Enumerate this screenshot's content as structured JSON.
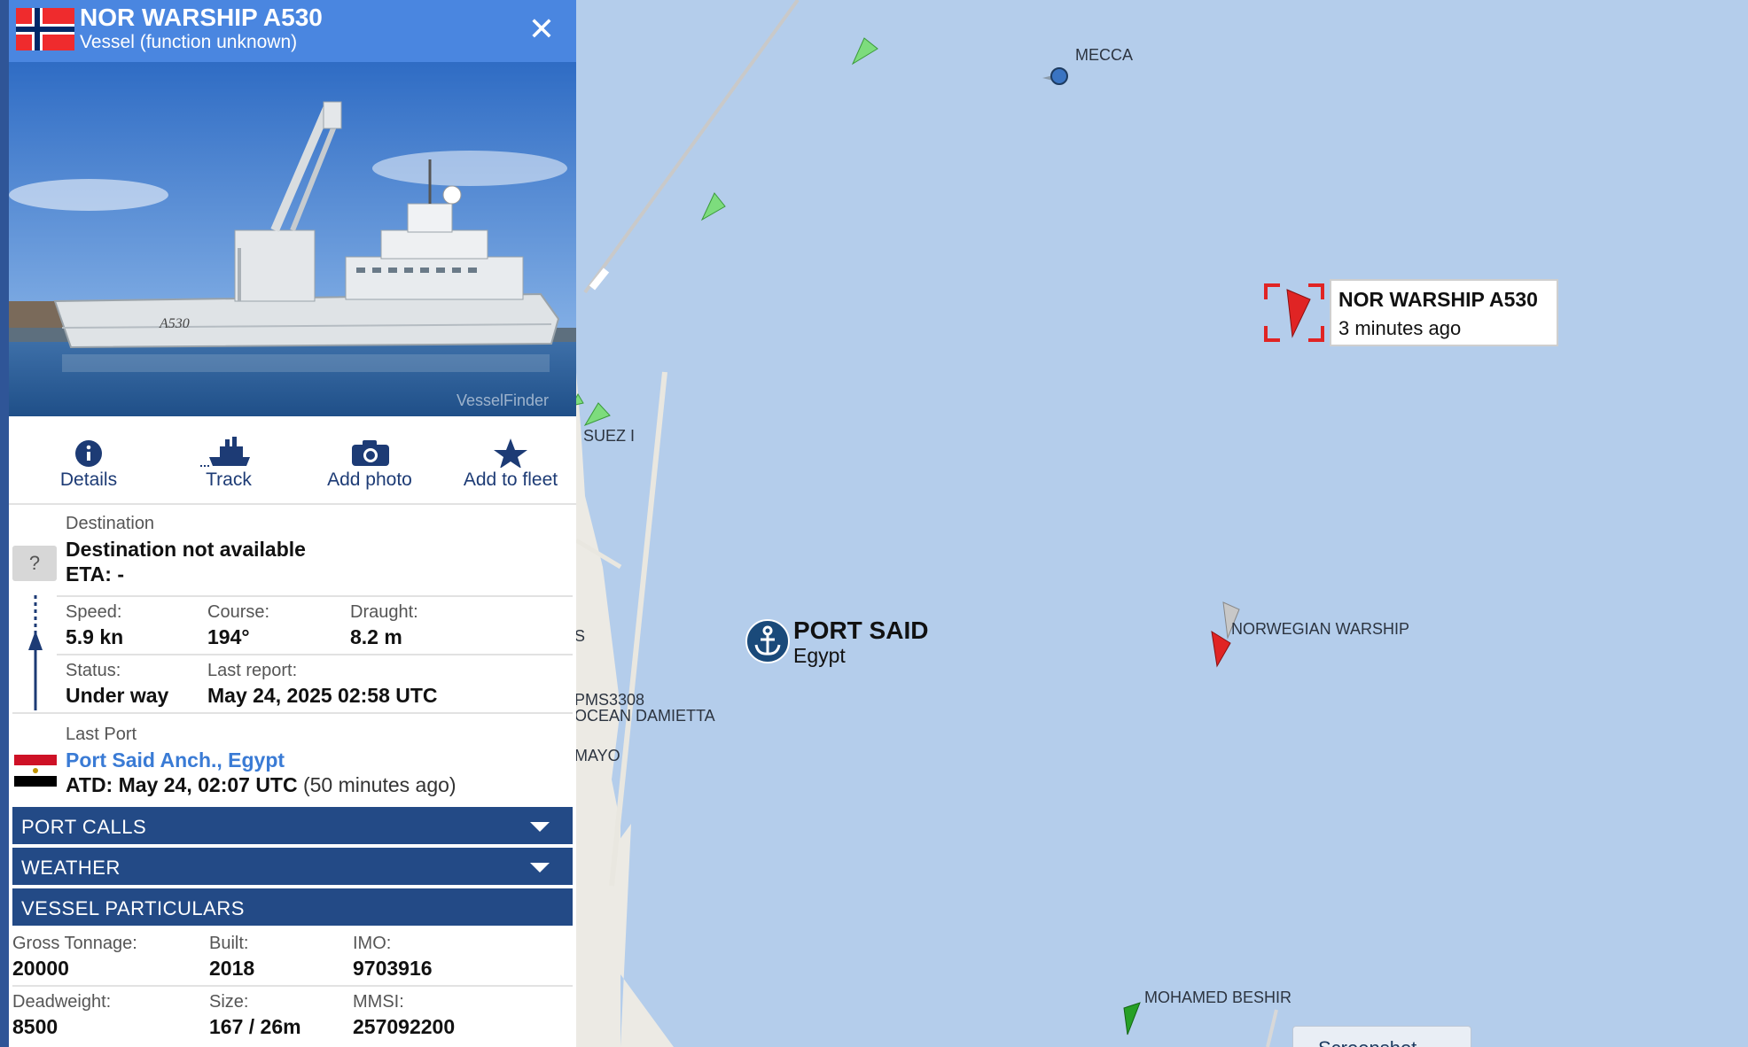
{
  "panel": {
    "title": "NOR WARSHIP A530",
    "subtitle": "Vessel (function unknown)",
    "close_symbol": "✕",
    "photo_watermark": "VesselFinder",
    "photo_hull_text": "A530",
    "actions": [
      {
        "label": "Details",
        "icon": "info-icon"
      },
      {
        "label": "Track",
        "icon": "ship-track-icon"
      },
      {
        "label": "Add photo",
        "icon": "camera-icon"
      },
      {
        "label": "Add to fleet",
        "icon": "star-icon"
      }
    ],
    "destination": {
      "label": "Destination",
      "value": "Destination not available",
      "eta": "ETA: -",
      "unknown_icon": "?"
    },
    "speed": {
      "label": "Speed:",
      "value": "5.9 kn"
    },
    "course": {
      "label": "Course:",
      "value": "194°"
    },
    "draught": {
      "label": "Draught:",
      "value": "8.2 m"
    },
    "status": {
      "label": "Status:",
      "value": "Under way"
    },
    "last_report": {
      "label": "Last report:",
      "value": "May 24, 2025 02:58 UTC"
    },
    "last_port": {
      "label": "Last Port",
      "name": "Port Said Anch., Egypt",
      "atd": "ATD: May 24, 02:07 UTC",
      "ago": "(50 minutes ago)"
    },
    "sections": [
      {
        "label": "PORT CALLS",
        "expandable": true
      },
      {
        "label": "WEATHER",
        "expandable": true
      },
      {
        "label": "VESSEL PARTICULARS",
        "expandable": false
      }
    ],
    "particulars": {
      "gross_tonnage": {
        "label": "Gross Tonnage:",
        "value": "20000"
      },
      "built": {
        "label": "Built:",
        "value": "2018"
      },
      "imo": {
        "label": "IMO:",
        "value": "9703916"
      },
      "deadweight": {
        "label": "Deadweight:",
        "value": "8500"
      },
      "size": {
        "label": "Size:",
        "value": "167 / 26m"
      },
      "mmsi": {
        "label": "MMSI:",
        "value": "257092200"
      }
    }
  },
  "map": {
    "labels": {
      "mecca": "MECCA",
      "suez": "SUEZ I",
      "s_partial": "S",
      "pms": "PMS3308",
      "ocean_damietta": "OCEAN DAMIETTA",
      "mayo": "MAYO",
      "norwegian_warship": "NORWEGIAN WARSHIP",
      "mohamed_beshir": "MOHAMED BESHIR"
    },
    "port": {
      "name": "PORT SAID",
      "country": "Egypt"
    },
    "callout": {
      "name": "NOR WARSHIP A530",
      "time": "3 minutes ago"
    },
    "screenshot_button": "Screenshot",
    "colors": {
      "sea": "#b4cdeb",
      "land": "#eceae4",
      "header": "#4a86e0",
      "section": "#234a86",
      "link": "#3a7bd5",
      "selected_vessel": "#e02424",
      "cargo_vessel": "#7ddc7d"
    }
  }
}
